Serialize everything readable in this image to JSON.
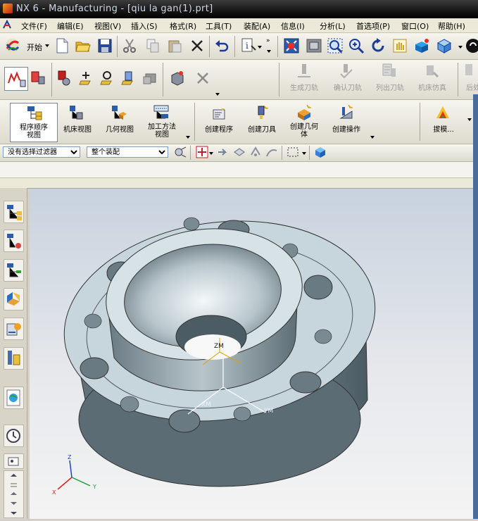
{
  "window": {
    "title": "NX 6 - Manufacturing - [qiu la gan(1).prt]"
  },
  "menu": {
    "items": [
      "文件(F)",
      "编辑(E)",
      "视图(V)",
      "插入(S)",
      "格式(R)",
      "工具(T)",
      "装配(A)",
      "信息(I)",
      "分析(L)",
      "首选项(P)",
      "窗口(O)",
      "帮助(H)"
    ]
  },
  "toolbar1": {
    "start_label": "开始"
  },
  "operations_toolbar": {
    "generate_path": "生成刀轨",
    "verify_path": "确认刀轨",
    "list_path": "列出刀轨",
    "machine_sim": "机床仿真",
    "postprocess": "后处"
  },
  "navigator_toolbar": {
    "program_order_view": "程序顺序\n视图",
    "machine_tool_view": "机床视图",
    "geometry_view": "几何视图",
    "machining_method_view": "加工方法\n视图"
  },
  "insert_toolbar": {
    "create_program": "创建程序",
    "create_tool": "创建刀具",
    "create_geometry": "创建几何\n体",
    "create_operation": "创建操作",
    "draft": "拔模..."
  },
  "selection_bar": {
    "filter_value": "没有选择过滤器",
    "scope_value": "整个装配"
  },
  "model_labels": {
    "zm": "ZM",
    "xm": "XM",
    "ym": "YM"
  },
  "triad": {
    "x": "X",
    "y": "Y",
    "z": "Z"
  },
  "colors": {
    "titlebar": "#111111",
    "part_face": "#c7d6dc",
    "part_side": "#6e7f88",
    "csys": "#e0a000"
  }
}
